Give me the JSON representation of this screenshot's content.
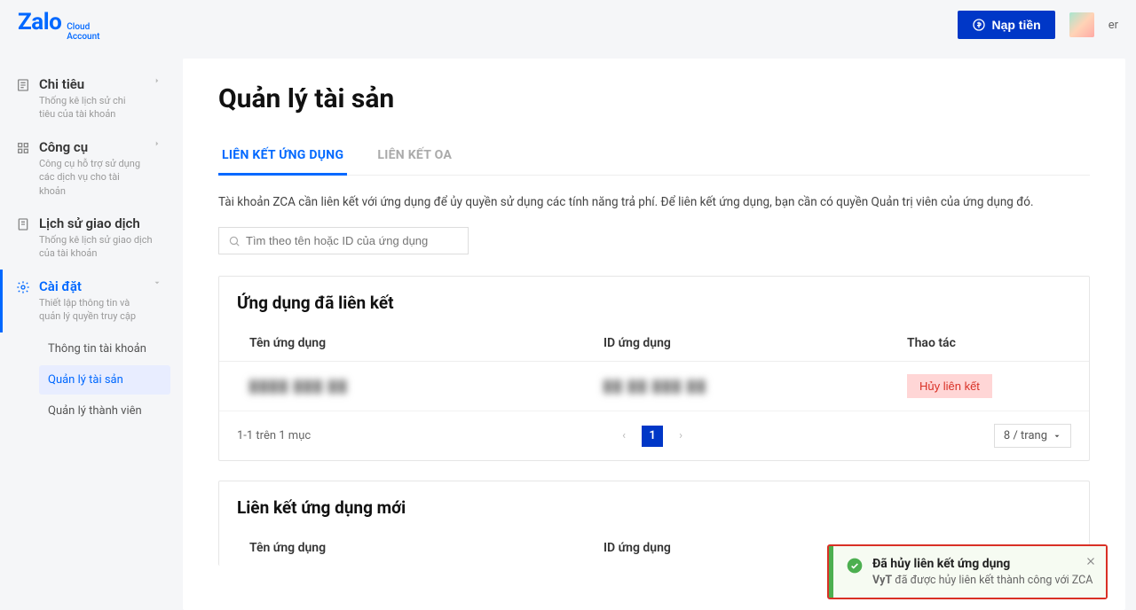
{
  "header": {
    "logo_main": "Zalo",
    "logo_sub1": "Cloud",
    "logo_sub2": "Account",
    "topup_label": "Nạp tiền",
    "username": "er"
  },
  "sidebar": {
    "items": [
      {
        "title": "Chi tiêu",
        "desc": "Thống kê lịch sử chi tiêu của tài khoản"
      },
      {
        "title": "Công cụ",
        "desc": "Công cụ hỗ trợ sử dụng các dịch vụ cho tài khoản"
      },
      {
        "title": "Lịch sử giao dịch",
        "desc": "Thống kê lịch sử giao dịch của tài khoản"
      },
      {
        "title": "Cài đặt",
        "desc": "Thiết lập thông tin và quản lý quyền truy cập"
      }
    ],
    "sub": [
      "Thông tin tài khoản",
      "Quản lý tài sản",
      "Quản lý thành viên"
    ]
  },
  "main": {
    "title": "Quản lý tài sản",
    "tabs": [
      "LIÊN KẾT ỨNG DỤNG",
      "LIÊN KẾT OA"
    ],
    "desc": "Tài khoản ZCA cần liên kết với ứng dụng để ủy quyền sử dụng các tính năng trả phí. Để liên kết ứng dụng, bạn cần có quyền Quản trị viên của ứng dụng đó.",
    "search_placeholder": "Tìm theo tên hoặc ID của ứng dụng",
    "linked": {
      "title": "Ứng dụng đã liên kết",
      "col_name": "Tên ứng dụng",
      "col_id": "ID ứng dụng",
      "col_act": "Thao tác",
      "row_name": "████ ███ ██",
      "row_id": "██ ██ ███ ██",
      "unlink_label": "Hủy liên kết",
      "paging_text": "1-1 trên 1 mục",
      "page_current": "1",
      "page_size": "8 / trang"
    },
    "new_link": {
      "title": "Liên kết ứng dụng mới",
      "col_name": "Tên ứng dụng",
      "col_id": "ID ứng dụng"
    }
  },
  "toast": {
    "title": "Đã hủy liên kết ứng dụng",
    "msg_prefix": "VyT",
    "msg_rest": " đã được hủy liên kết thành công với ZCA"
  }
}
